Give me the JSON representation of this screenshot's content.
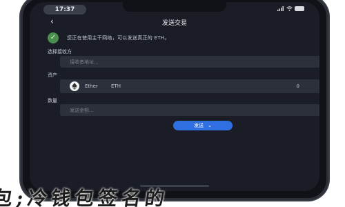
{
  "status_bar": {
    "time": "17:37"
  },
  "nav": {
    "back_glyph": "‹",
    "title": "发送交易"
  },
  "warning": {
    "icon": "shield-check-icon",
    "text": "您正在使用主干网络，可以发送真正的 ETH。"
  },
  "fields": {
    "recipient": {
      "label": "选择接收方",
      "placeholder": "接收者地址..."
    },
    "asset": {
      "label": "资产",
      "name": "Ether",
      "symbol": "ETH",
      "balance": "0",
      "logo": "ethereum-icon"
    },
    "amount": {
      "label": "数量",
      "placeholder": "发送金额..."
    }
  },
  "send_button": {
    "label": "发送",
    "chevron": "⌄"
  },
  "caption": {
    "text": "包;冷钱包签名的"
  },
  "colors": {
    "frame": "#101217",
    "screen": "#1a1d26",
    "field": "#2c303b",
    "accent": "#2f6fe2",
    "warning_icon": "#4a8f4d"
  }
}
